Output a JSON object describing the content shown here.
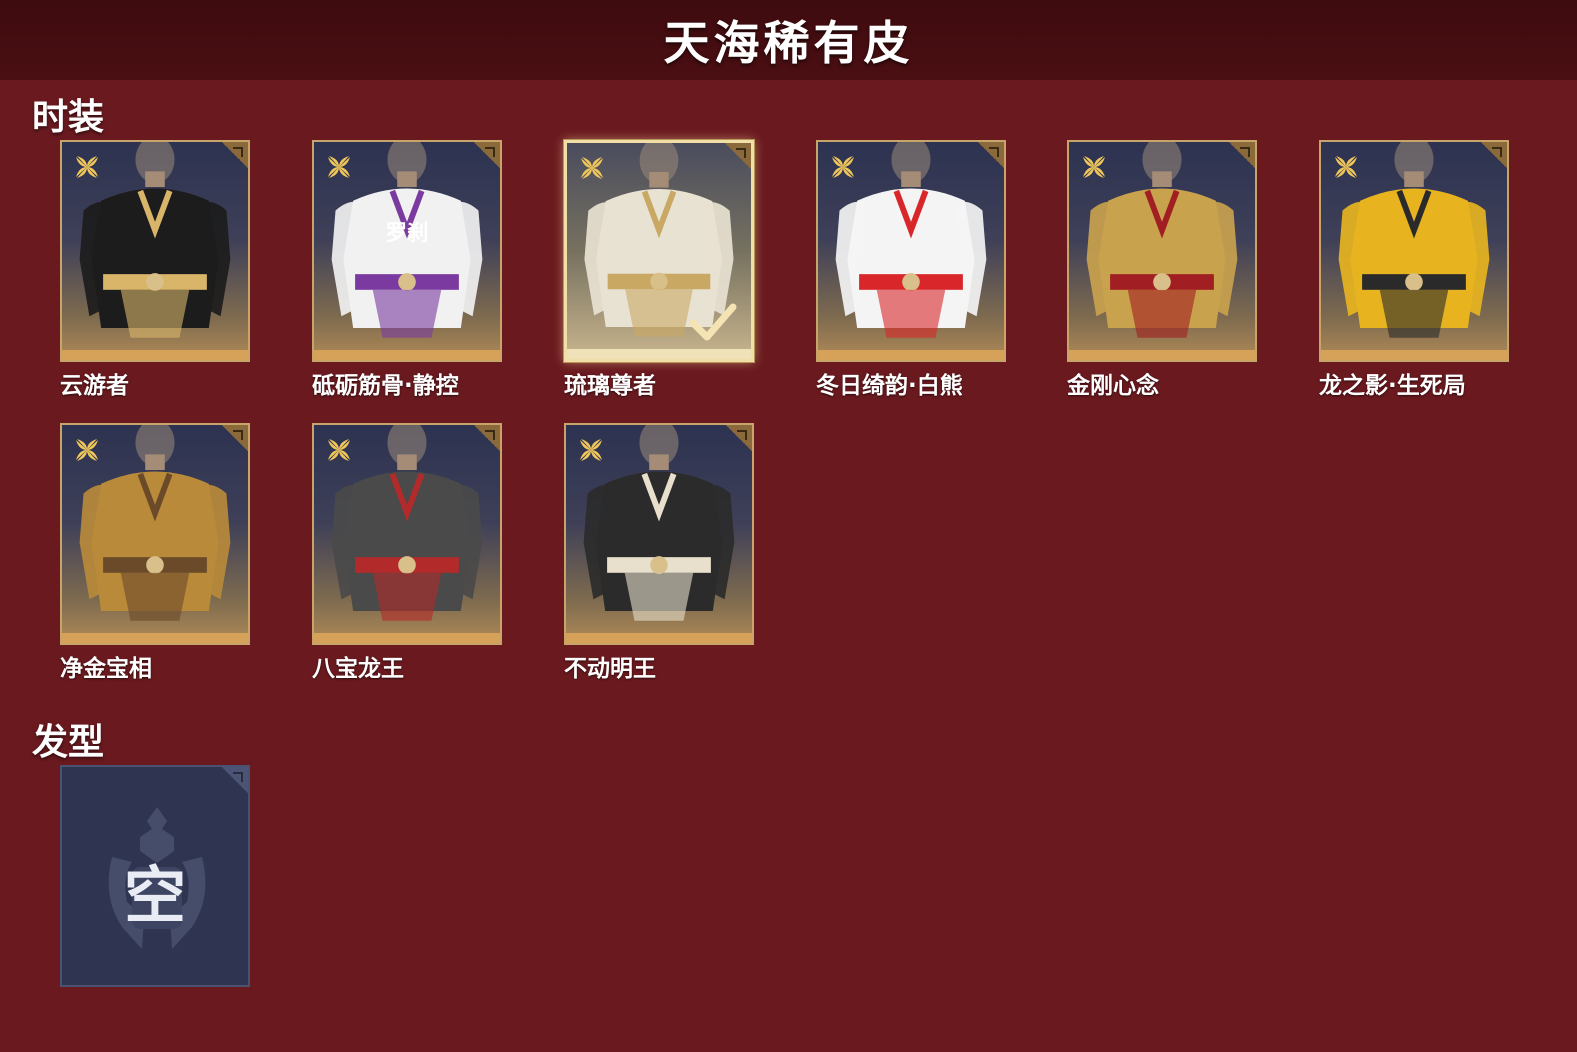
{
  "header": {
    "title": "天海稀有皮"
  },
  "sections": {
    "costumes": {
      "title": "时装",
      "items": [
        {
          "name": "云游者",
          "primary": "#1c1c1c",
          "accent": "#d9b56a",
          "selected": false
        },
        {
          "name": "砥砺筋骨·静控",
          "primary": "#f1f1f1",
          "accent": "#7a3aa0",
          "chest_text": "罗刹",
          "selected": false
        },
        {
          "name": "琉璃尊者",
          "primary": "#e8e2d2",
          "accent": "#c9a864",
          "selected": true
        },
        {
          "name": "冬日绮韵·白熊",
          "primary": "#f4f4f4",
          "accent": "#d8262a",
          "selected": false
        },
        {
          "name": "金刚心念",
          "primary": "#c9a24e",
          "accent": "#a11e22",
          "selected": false
        },
        {
          "name": "龙之影·生死局",
          "primary": "#e7b420",
          "accent": "#2a2a2a",
          "selected": false
        },
        {
          "name": "净金宝相",
          "primary": "#b88a3a",
          "accent": "#6b4a2a",
          "selected": false
        },
        {
          "name": "八宝龙王",
          "primary": "#4a4a4a",
          "accent": "#b22a2a",
          "selected": false
        },
        {
          "name": "不动明王",
          "primary": "#2b2b2b",
          "accent": "#e8e0cc",
          "selected": false
        }
      ]
    },
    "hairstyles": {
      "title": "发型",
      "empty_text": "空"
    }
  },
  "colors": {
    "background": "#6a1a1f",
    "header": "#3e0b0e",
    "card_border": "#c7a46a",
    "rarity_star": "#f0c75a"
  },
  "icons": {
    "rarity": "rarity-star-icon",
    "equipped": "check-icon",
    "empty": "empty-emblem-icon"
  }
}
